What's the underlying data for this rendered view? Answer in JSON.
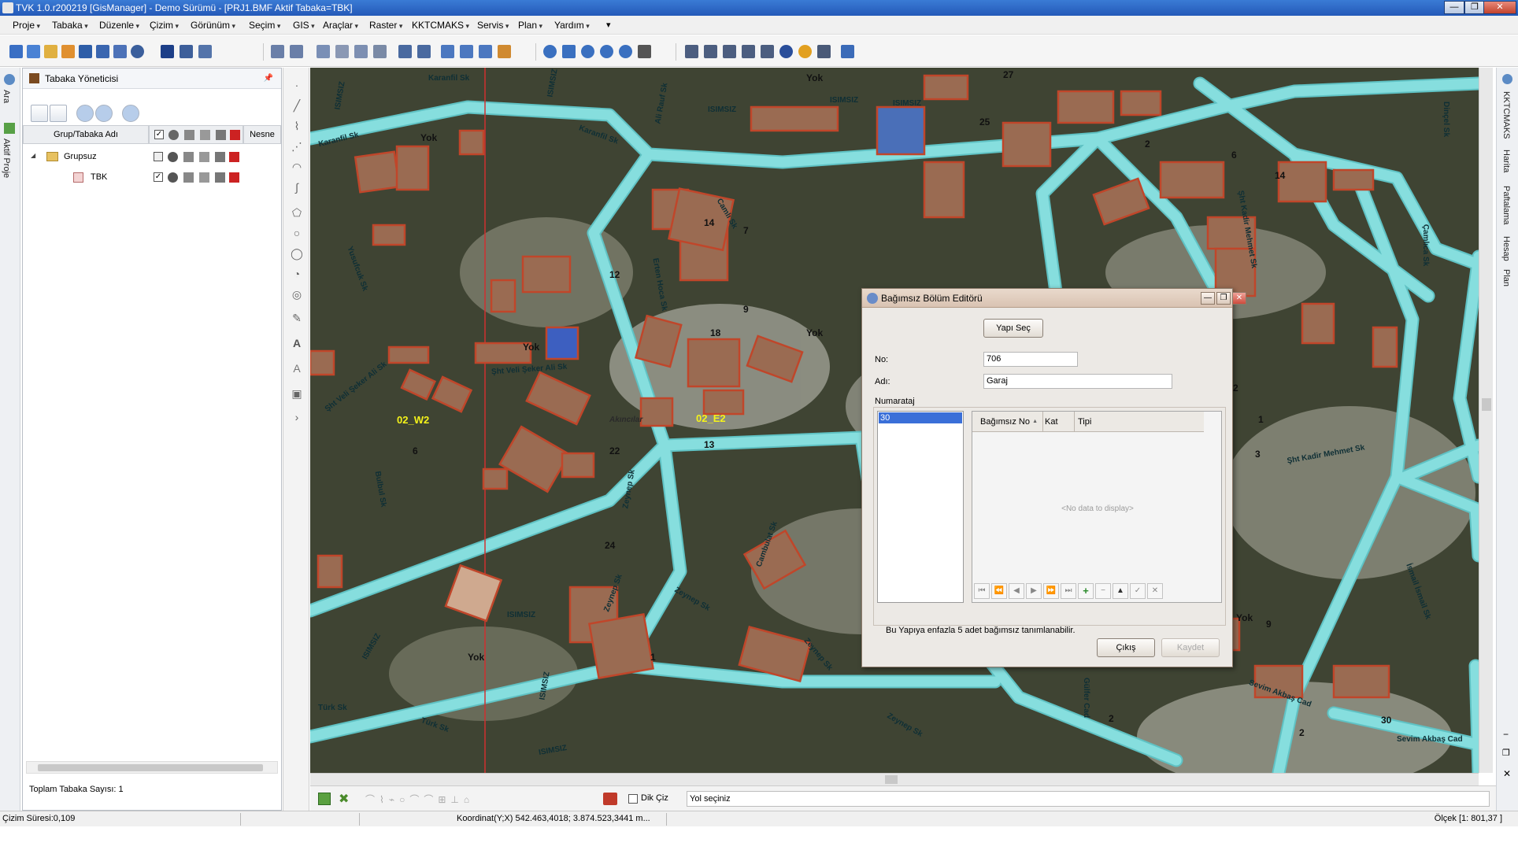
{
  "window": {
    "title": "TVK 1.0.r200219 [GisManager] - Demo Sürümü - [PRJ1.BMF  Aktif Tabaka=TBK]",
    "minimize": "—",
    "maximize": "❐",
    "close": "✕"
  },
  "menubar": {
    "items": [
      "Proje",
      "Tabaka",
      "Düzenle",
      "Çizim",
      "Görünüm",
      "Seçim",
      "GIS",
      "Araçlar",
      "Raster",
      "KKTCMAKS",
      "Servis",
      "Plan",
      "Yardım"
    ],
    "more": "▾"
  },
  "left_tabs": [
    "Ara",
    "Aktif Proje"
  ],
  "right_tabs": [
    "KKTCMAKS",
    "Harita",
    "Paftalama",
    "Hesap",
    "Plan"
  ],
  "layer_panel": {
    "title": "Tabaka Yöneticisi",
    "pin": "📌",
    "columns": {
      "name": "Grup/Tabaka Adı",
      "object": "Nesne"
    },
    "tree": [
      {
        "label": "Grupsuz",
        "expander": "◢"
      },
      {
        "label": "TBK"
      }
    ],
    "total_label": "Toplam Tabaka Sayısı: 1"
  },
  "map": {
    "street_labels": [
      "Karanfil Sk",
      "Karanfil Sk",
      "Karanfil Sk",
      "Ali Rauf Sk",
      "ISIMSIZ",
      "ISIMSIZ",
      "ISIMSIZ",
      "ISIMSIZ",
      "ISIMSIZ",
      "Camlı Sk",
      "Yusufcuk Sk",
      "Erten Hoca Sk",
      "Şht Veli Şeker Ali Sk",
      "Şht Veli Şeker Ali Sk",
      "Bulbul Sk",
      "Zeynep Sk",
      "Zeynep Sk",
      "Zeynep Sk",
      "Zeynep Sk",
      "Zeynep Sk",
      "Cambulat Sk",
      "ISIMSIZ",
      "ISIMSIZ",
      "ISIMSIZ",
      "Türk Sk",
      "Türk Sk",
      "ISIMSIZ",
      "Şht Kadir Mehmet Sk",
      "Şht Kadir Mehmet Sk",
      "Çamlıca Sk",
      "İsmail İsmail Sk",
      "Sevim Akbaş Cad",
      "Sevim Akbaş Cad",
      "Gülfer Cad",
      "Dinçel Sk",
      "Akıncılar"
    ],
    "building_numbers": [
      "Yok",
      "Yok",
      "27",
      "25",
      "2",
      "6",
      "14",
      "14",
      "7",
      "12",
      "Yok",
      "18",
      "9",
      "Yok",
      "6",
      "22",
      "13",
      "24",
      "Yok",
      "1",
      "2",
      "1",
      "3",
      "9",
      "Yok",
      "2",
      "30",
      "2"
    ],
    "parcel_labels": [
      "02_W2",
      "02_E2"
    ]
  },
  "map_bottom": {
    "dik_ciz": "Dik Çiz",
    "status_msg": "Yol seçiniz"
  },
  "statusbar": {
    "draw_time": "Çizim Süresi:0,109",
    "coordinate": "Koordinat(Y;X)  542.463,4018; 3.874.523,3441 m...",
    "scale": "Ölçek [1: 801,37 ]"
  },
  "dialog": {
    "title": "Bağımsız Bölüm Editörü",
    "select_button": "Yapı Seç",
    "no_label": "No:",
    "no_value": "706",
    "name_label": "Adı:",
    "name_value": "Garaj",
    "group_label": "Numarataj",
    "numarataj_items": [
      "30"
    ],
    "grid_columns": [
      "Bağımsız No",
      "Kat",
      "Tipi"
    ],
    "sort_indicator": "▲",
    "empty_text": "<No data to display>",
    "nav_buttons": [
      "⏮",
      "⏪",
      "◀",
      "▶",
      "⏩",
      "⏭",
      "+",
      "−",
      "▲",
      "✓",
      "✕"
    ],
    "info_text": "Bu Yapıya enfazla 5 adet bağımsız tanımlanabilir.",
    "exit_button": "Çıkış",
    "save_button": "Kaydet",
    "minimize": "—",
    "maximize": "❐",
    "close": "✕"
  },
  "colors": {
    "road": "#86dede",
    "road_edge": "#5fc2c4",
    "building": "#c0462a",
    "accent_blue": "#2c67c9"
  }
}
